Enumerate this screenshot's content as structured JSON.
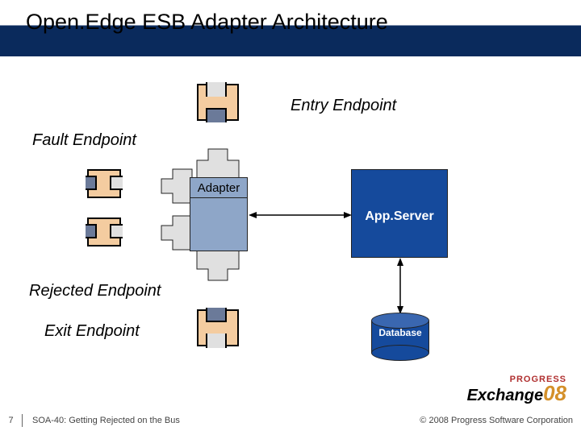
{
  "title": "Open.Edge ESB Adapter Architecture",
  "labels": {
    "entry": "Entry Endpoint",
    "fault": "Fault Endpoint",
    "rejected": "Rejected Endpoint",
    "exit": "Exit Endpoint",
    "adapter": "Adapter",
    "appserver": "App.Server",
    "database": "Database"
  },
  "footer": {
    "page": "7",
    "talk": "SOA-40: Getting Rejected on the Bus",
    "copyright": "© 2008 Progress Software Corporation"
  },
  "logo": {
    "brand_small": "PROGRESS",
    "main": "Exchange",
    "year": "08"
  }
}
